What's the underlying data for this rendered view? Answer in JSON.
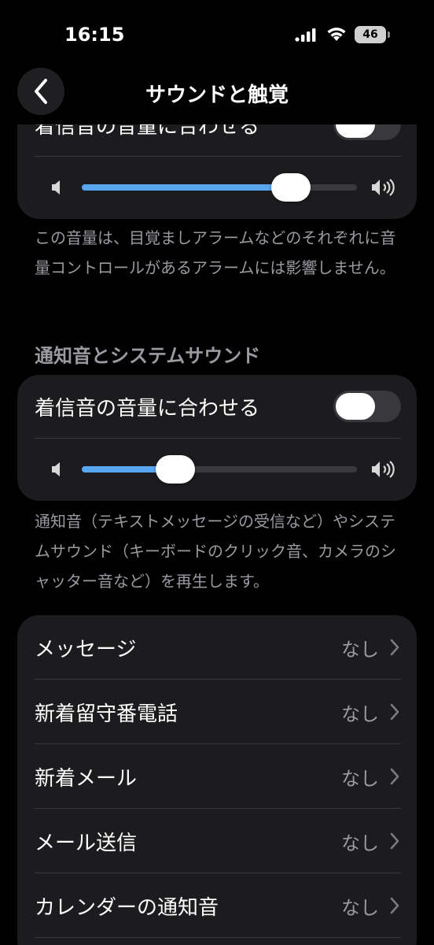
{
  "status_bar": {
    "time": "16:15",
    "battery": "46",
    "icons": [
      "cellular-signal-icon",
      "wifi-icon",
      "battery-icon"
    ]
  },
  "nav": {
    "title": "サウンドと触覚",
    "back_icon": "chevron-left-icon"
  },
  "alarm_section": {
    "toggle_label": "着信音の音量に合わせる",
    "toggle_on": false,
    "volume_level": 0.76,
    "footnote": "この音量は、目覚ましアラームなどのそれぞれに音量コントロールがあるアラームには影響しません。"
  },
  "notification_section": {
    "header": "通知音とシステムサウンド",
    "toggle_label": "着信音の音量に合わせる",
    "toggle_on": false,
    "volume_level": 0.34,
    "footnote": "通知音（テキストメッセージの受信など）やシステムサウンド（キーボードのクリック音、カメラのシャッター音など）を再生します。"
  },
  "sound_list": [
    {
      "label": "メッセージ",
      "value": "なし"
    },
    {
      "label": "新着留守番電話",
      "value": "なし"
    },
    {
      "label": "新着メール",
      "value": "なし"
    },
    {
      "label": "メール送信",
      "value": "なし"
    },
    {
      "label": "カレンダーの通知音",
      "value": "なし"
    }
  ],
  "colors": {
    "accent": "#58a6f0",
    "card": "#1c1c1e",
    "secondary_text": "#9a9aa0"
  }
}
